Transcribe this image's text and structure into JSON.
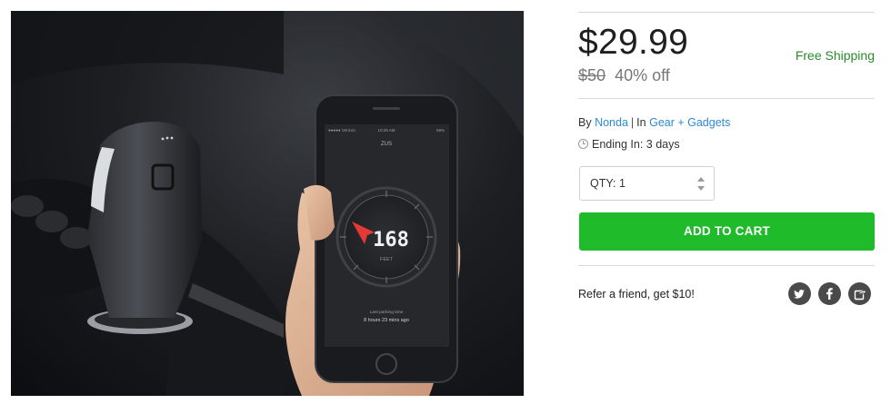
{
  "product": {
    "price": "$29.99",
    "original_price": "$50",
    "discount": "40% off",
    "shipping": "Free Shipping",
    "by_label": "By",
    "brand": "Nonda",
    "in_label": "In",
    "category": "Gear + Gadgets",
    "ending_label": "Ending In: 3 days"
  },
  "purchase": {
    "qty_label": "QTY: 1",
    "add_to_cart": "ADD TO CART"
  },
  "referral": {
    "text": "Refer a friend, get $10!"
  },
  "social": [
    "twitter-icon",
    "facebook-icon",
    "share-icon"
  ],
  "phone_screen": {
    "status_left": "●●●●● Verizon",
    "status_time": "10:28 AM",
    "status_right": "59%",
    "app_title": "ZUS",
    "distance": "168",
    "unit": "FEET",
    "parking_label": "Last parking time",
    "parking_time": "8 hours 23 mins ago"
  },
  "colors": {
    "accent_green": "#1fbb2a",
    "link_blue": "#2c8ad6",
    "shipping_green": "#2b8a2b",
    "compass_red": "#e53935"
  }
}
